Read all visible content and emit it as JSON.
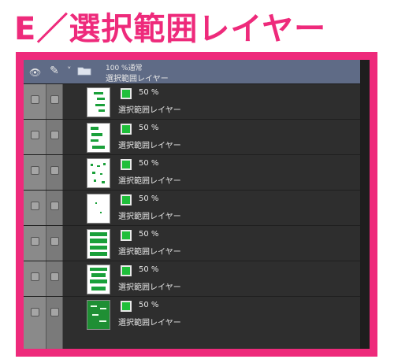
{
  "heading": "E／選択範囲レイヤー",
  "folder": {
    "blend": "100 %通常",
    "name": "選択範囲レイヤー",
    "icons": [
      "eye-icon",
      "pen-icon",
      "chevron-down-icon",
      "folder-icon"
    ]
  },
  "layers": [
    {
      "opacity": "50 %",
      "name": "選択範囲レイヤー"
    },
    {
      "opacity": "50 %",
      "name": "選択範囲レイヤー"
    },
    {
      "opacity": "50 %",
      "name": "選択範囲レイヤー"
    },
    {
      "opacity": "50 %",
      "name": "選択範囲レイヤー"
    },
    {
      "opacity": "50 %",
      "name": "選択範囲レイヤー"
    },
    {
      "opacity": "50 %",
      "name": "選択範囲レイヤー"
    },
    {
      "opacity": "50 %",
      "name": "選択範囲レイヤー"
    }
  ],
  "colors": {
    "accent": "#ee2a7b",
    "selection": "#1fbf3a",
    "folder_row": "#5f6b86"
  }
}
